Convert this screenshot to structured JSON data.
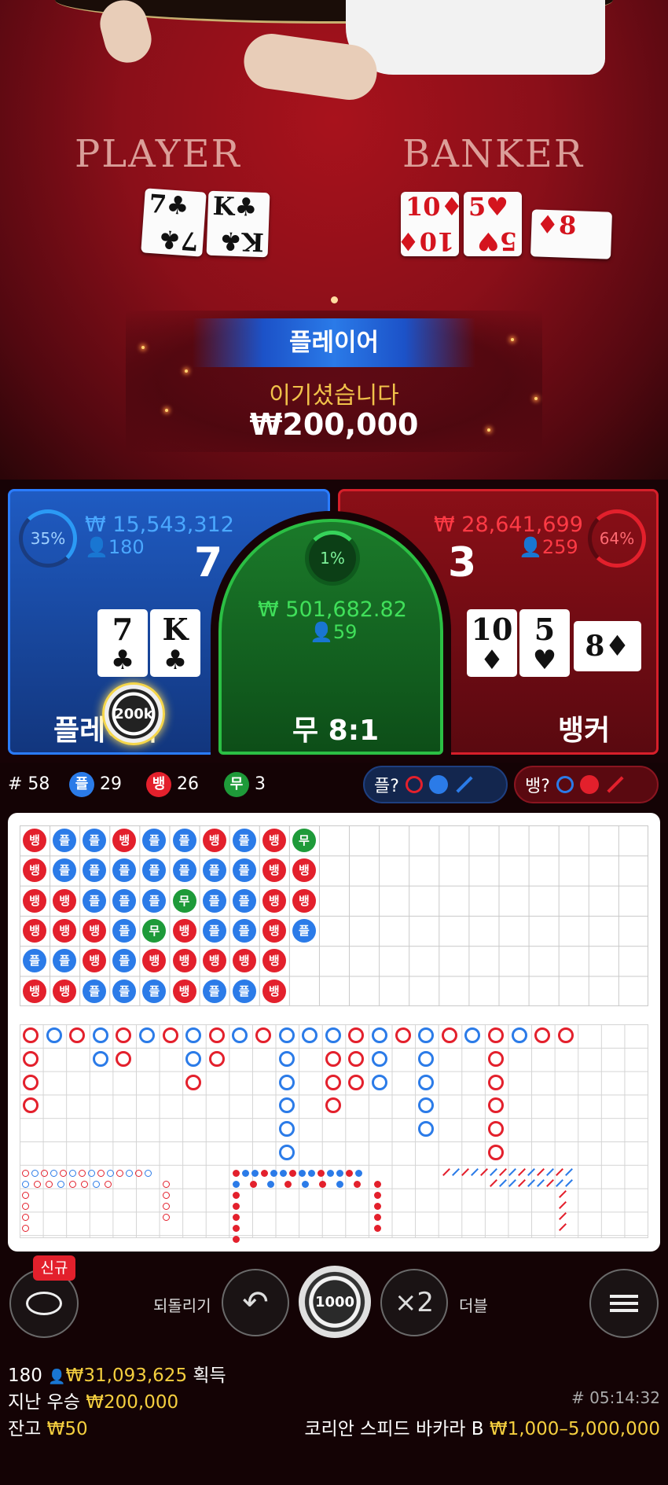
{
  "video": {
    "player_title": "PLAYER",
    "banker_title": "BANKER",
    "player_cards": [
      {
        "rank": "7",
        "suit": "♣",
        "color": "blk"
      },
      {
        "rank": "K",
        "suit": "♣",
        "color": "blk"
      }
    ],
    "banker_cards": [
      {
        "rank": "10",
        "suit": "♦",
        "color": "red"
      },
      {
        "rank": "5",
        "suit": "♥",
        "color": "red"
      },
      {
        "rank": "8",
        "suit": "♦",
        "color": "red"
      }
    ]
  },
  "result": {
    "winner": "플레이어",
    "message": "이기셨습니다",
    "amount": "₩200,000"
  },
  "bets": {
    "player": {
      "label": "플레이어",
      "percent": "35%",
      "total": "₩ 15,543,312",
      "count": "180",
      "score": "7",
      "chip": "200k",
      "cards": [
        {
          "rank": "7",
          "suit": "♣"
        },
        {
          "rank": "K",
          "suit": "♣"
        }
      ]
    },
    "tie": {
      "label": "무 8:1",
      "percent": "1%",
      "total": "₩ 501,682.82",
      "count": "59"
    },
    "banker": {
      "label": "뱅커",
      "percent": "64%",
      "total": "₩ 28,641,699",
      "count": "259",
      "score": "3",
      "cards": [
        {
          "rank": "10",
          "suit": "♦"
        },
        {
          "rank": "5",
          "suit": "♥"
        },
        {
          "rank": "8",
          "suit": "♦"
        }
      ]
    }
  },
  "stats": {
    "round": "# 58",
    "player_icon": "플",
    "player_count": "29",
    "banker_icon": "뱅",
    "banker_count": "26",
    "tie_icon": "무",
    "tie_count": "3",
    "ask_player": "플?",
    "ask_banker": "뱅?"
  },
  "road": {
    "bead": [
      [
        "B",
        "B",
        "B",
        "B",
        "P",
        "B"
      ],
      [
        "P",
        "P",
        "B",
        "B",
        "P",
        "B"
      ],
      [
        "P",
        "P",
        "P",
        "B",
        "B",
        "P"
      ],
      [
        "B",
        "P",
        "P",
        "P",
        "P",
        "P"
      ],
      [
        "P",
        "P",
        "P",
        "T",
        "B",
        "P"
      ],
      [
        "P",
        "P",
        "T",
        "B",
        "B",
        "B"
      ],
      [
        "B",
        "P",
        "P",
        "P",
        "B",
        "P"
      ],
      [
        "P",
        "P",
        "P",
        "P",
        "B",
        "P"
      ],
      [
        "B",
        "B",
        "B",
        "B",
        "B",
        "B"
      ],
      [
        "T",
        "B",
        "B",
        "P"
      ]
    ]
  },
  "controls": {
    "new_badge": "신규",
    "undo_label": "되돌리기",
    "chip_value": "1000",
    "double_symbol": "×2",
    "double_label": "더블"
  },
  "footer": {
    "players": "180",
    "won": "₩31,093,625",
    "won_suffix": "획득",
    "last_win_label": "지난 우승",
    "last_win": "₩200,000",
    "game_id": "# 05:14:32",
    "balance_label": "잔고",
    "balance": "₩50",
    "table_name": "코리안 스피드 바카라 B",
    "limits": "₩1,000–5,000,000"
  },
  "colors": {
    "player": "#2b7be8",
    "banker": "#e3202c",
    "tie": "#1e9a39",
    "gold": "#f5cf3f"
  }
}
